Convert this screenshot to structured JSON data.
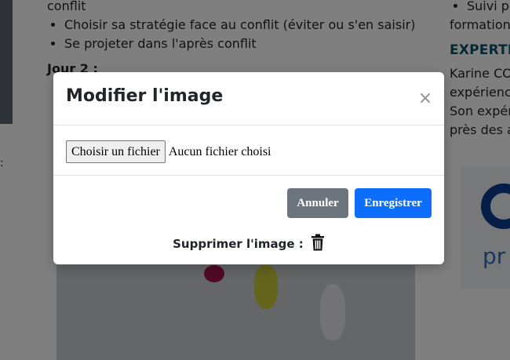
{
  "background": {
    "main": {
      "top_line": "conflit",
      "bullets": [
        "Choisir sa stratégie face au conflit (éviter ou s'en saisir)",
        "Se projeter dans l'après conflit"
      ],
      "day2_heading": "Jour 2 :",
      "left_colon": ":"
    },
    "right": {
      "bullet": "Suivi pe",
      "line2": "formation",
      "heading": "EXPERTIS",
      "para_lines": [
        "Karine COF",
        "expérience",
        "Son expéri",
        "près des a"
      ],
      "logo_text": "pr"
    }
  },
  "modal": {
    "title": "Modifier l'image",
    "close_symbol": "×",
    "file_button_label": "Choisir un fichier",
    "file_status": "Aucun fichier choisi",
    "cancel_label": "Annuler",
    "save_label": "Enregistrer",
    "delete_label": "Supprimer l'image :"
  },
  "colors": {
    "save_button": "#0d6efd",
    "cancel_button": "#6c757d",
    "expertise_heading": "#0b5063"
  },
  "icons": {
    "close": "close-icon",
    "delete": "trash-icon"
  }
}
